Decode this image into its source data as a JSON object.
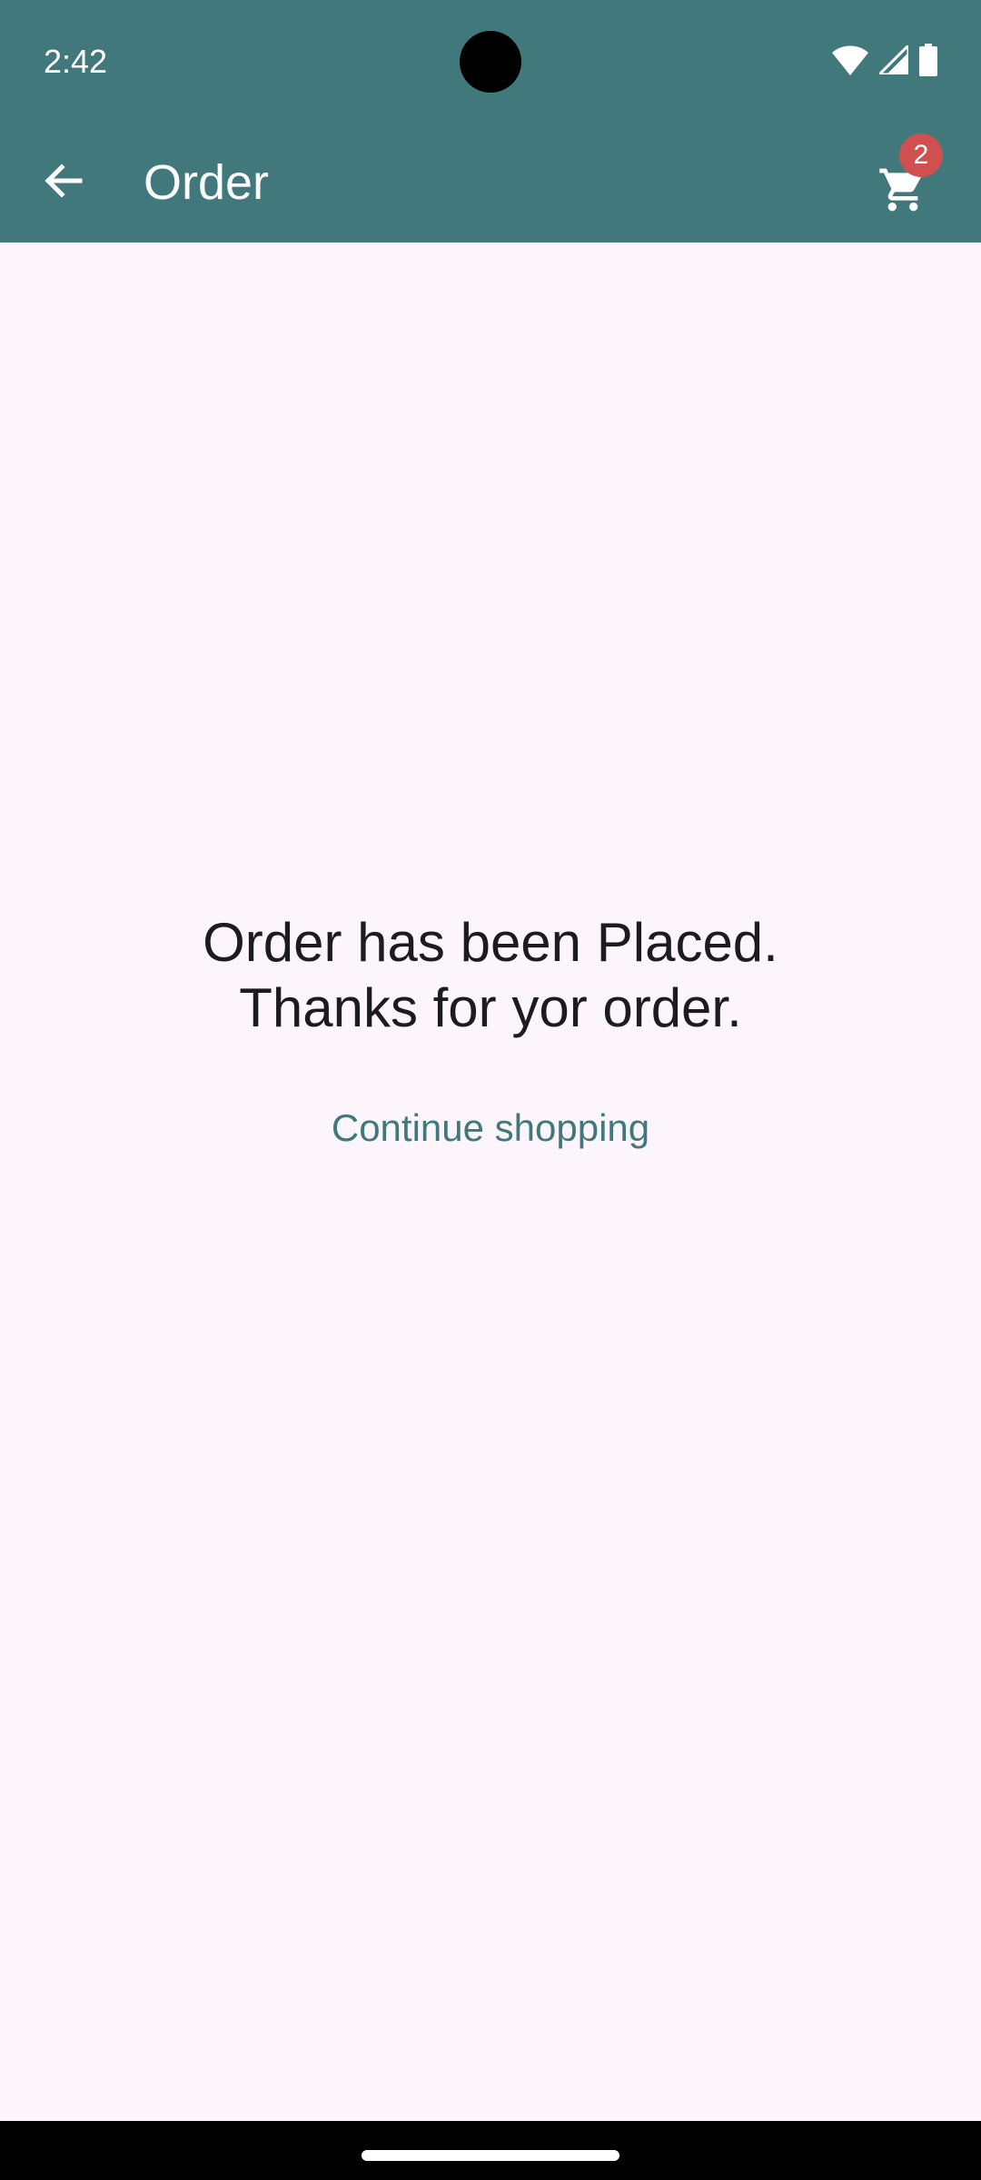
{
  "status_bar": {
    "time": "2:42",
    "icons": [
      "wifi-icon",
      "signal-icon",
      "battery-icon"
    ]
  },
  "app_bar": {
    "back_icon": "arrow-back-icon",
    "title": "Order",
    "cart_icon": "shopping-cart-icon",
    "cart_badge": "2"
  },
  "main": {
    "message_line1": "Order has been Placed.",
    "message_line2": "Thanks for yor order.",
    "continue_label": "Continue shopping"
  },
  "colors": {
    "primary": "#40787c",
    "background": "#fcf6fc",
    "badge": "#d05050",
    "text": "#1c1b1f"
  }
}
